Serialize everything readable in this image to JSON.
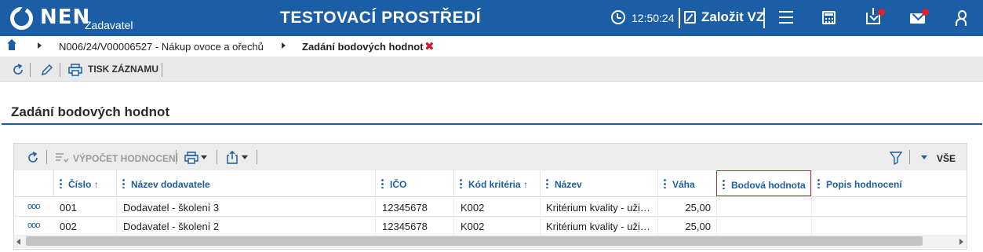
{
  "header": {
    "logo_text": "NEN",
    "logo_sub": "Zadavatel",
    "environment_title": "TESTOVACÍ PROSTŘEDÍ",
    "clock": "12:50:24",
    "new_tender_label": "Založit VZ",
    "brand_color": "#1c5ea6",
    "notification_color": "#d9232e"
  },
  "breadcrumb": {
    "items": [
      "N006/24/V00006527 - Nákup ovoce a ořechů"
    ],
    "current": "Zadání bodových hodnot",
    "close_symbol": "✖"
  },
  "record_toolbar": {
    "print_label": "TISK ZÁZNAMU"
  },
  "page": {
    "title": "Zadání bodových hodnot"
  },
  "grid": {
    "toolbar": {
      "compute_label": "VÝPOČET HODNOCENÍ",
      "filter_all_label": "VŠE"
    },
    "columns": [
      {
        "label": "Číslo",
        "sort": "↑"
      },
      {
        "label": "Název dodavatele",
        "sort": ""
      },
      {
        "label": "IČO",
        "sort": ""
      },
      {
        "label": "Kód kritéria",
        "sort": "↑"
      },
      {
        "label": "Název",
        "sort": ""
      },
      {
        "label": "Váha",
        "sort": ""
      },
      {
        "label": "Bodová hodnota",
        "sort": ""
      },
      {
        "label": "Popis hodnocení",
        "sort": ""
      }
    ],
    "rows": [
      {
        "menu": "ooo",
        "cislo": "001",
        "dodavatel": "Dodavatel - školení 3",
        "ico": "12345678",
        "kod": "K002",
        "nazev": "Kritérium kvality - uži…",
        "vaha": "25,00",
        "bodova": "",
        "popis": ""
      },
      {
        "menu": "ooo",
        "cislo": "002",
        "dodavatel": "Dodavatel - školení 2",
        "ico": "12345678",
        "kod": "K002",
        "nazev": "Kritérium kvality - uži…",
        "vaha": "25,00",
        "bodova": "",
        "popis": ""
      }
    ]
  }
}
